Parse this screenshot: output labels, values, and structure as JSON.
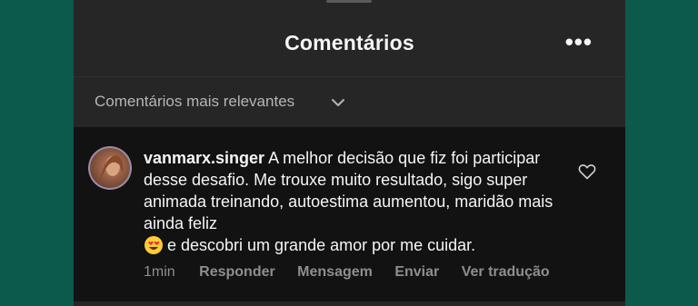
{
  "header": {
    "title": "Comentários",
    "more_icon": "more-horizontal-icon"
  },
  "sort": {
    "label": "Comentários mais relevantes",
    "icon": "chevron-down-icon"
  },
  "comment": {
    "username": "vanmarx.singer",
    "text_before_emoji": "A melhor decisão que fiz foi participar desse desafio. Me trouxe muito resultado, sigo super animada treinando, autoestima aumentou, maridão mais ainda feliz",
    "emoji": "heart-eyes-emoji",
    "text_after_emoji": "e descobri um grande amor por me cuidar.",
    "like_icon": "heart-outline-icon",
    "time": "1min",
    "actions": [
      "Responder",
      "Mensagem",
      "Enviar",
      "Ver tradução"
    ]
  },
  "colors": {
    "background": "#0b5a4c",
    "panel": "#262626",
    "comment_bg": "#121212",
    "text": "#f5f5f5",
    "muted": "#8e8e8e"
  }
}
